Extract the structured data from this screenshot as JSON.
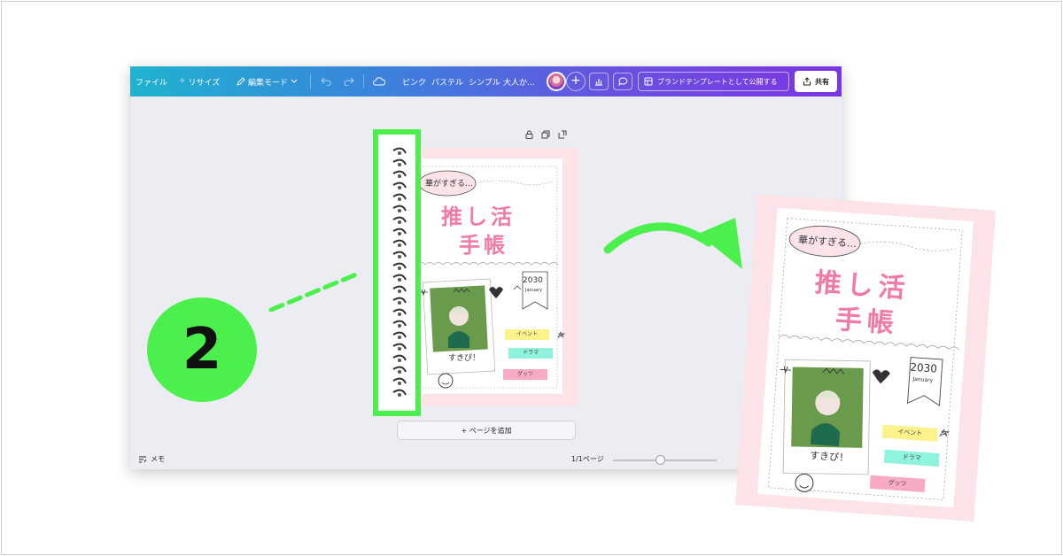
{
  "toolbar": {
    "file": "ファイル",
    "resize": "リサイズ",
    "edit_mode": "編集モード",
    "tags": [
      "ピンク",
      "パステル",
      "シンプル",
      "大人か..."
    ],
    "brand_template": "ブランドテンプレートとして公開する",
    "share": "共有"
  },
  "canvas": {
    "add_page": "+ ページを追加",
    "memo": "メモ",
    "page_count": "1/1ページ"
  },
  "notebook": {
    "bubble": "華がすぎる…",
    "title_line1": "推し活",
    "title_line2": "手帳",
    "year": "2030",
    "month": "January",
    "caption": "すきぴ！",
    "tags": [
      "イベント",
      "ドラマ",
      "グッツ"
    ]
  },
  "badge": "2",
  "colors": {
    "highlight_green": "#4cf04c",
    "title_pink": "#f07aa8",
    "tag_yellow": "#fbf28c",
    "tag_mint": "#8ff3de",
    "tag_pink": "#f8aac4"
  }
}
